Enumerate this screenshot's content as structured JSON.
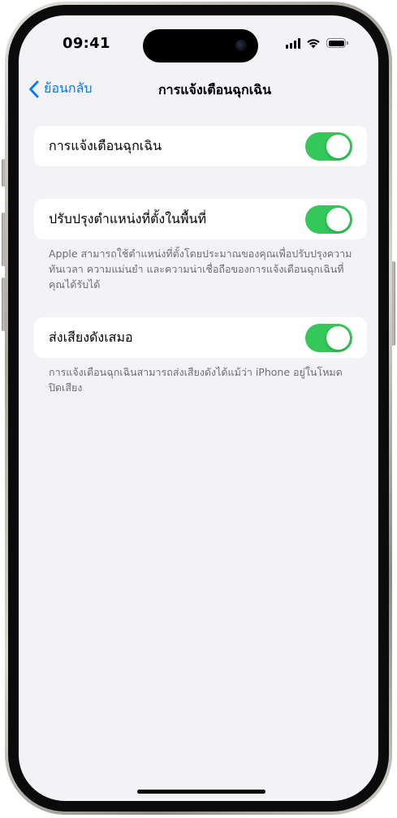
{
  "status_bar": {
    "time": "09:41"
  },
  "nav": {
    "back_label": "ย้อนกลับ",
    "title": "การแจ้งเตือนฉุกเฉิน"
  },
  "settings": [
    {
      "label": "การแจ้งเตือนฉุกเฉิน",
      "enabled": true,
      "footnote": ""
    },
    {
      "label": "ปรับปรุงตำแหน่งที่ตั้งในพื้นที่",
      "enabled": true,
      "footnote": "Apple สามารถใช้ตำแหน่งที่ตั้งโดยประมาณของคุณเพื่อปรับปรุงความทันเวลา ความแม่นยำ และความน่าเชื่อถือของการแจ้งเตือนฉุกเฉินที่คุณได้รับได้"
    },
    {
      "label": "ส่งเสียงดังเสมอ",
      "enabled": true,
      "footnote": "การแจ้งเตือนฉุกเฉินสามารถส่งเสียงดังได้แม้ว่า iPhone อยู่ในโหมดปิดเสียง"
    }
  ],
  "icons": {
    "back": "chevron-left-icon",
    "signal": "cellular-signal-icon",
    "wifi": "wifi-icon",
    "battery": "battery-icon"
  },
  "colors": {
    "accent": "#007aff",
    "toggle_on": "#34c759",
    "background": "#f2f2f7"
  }
}
